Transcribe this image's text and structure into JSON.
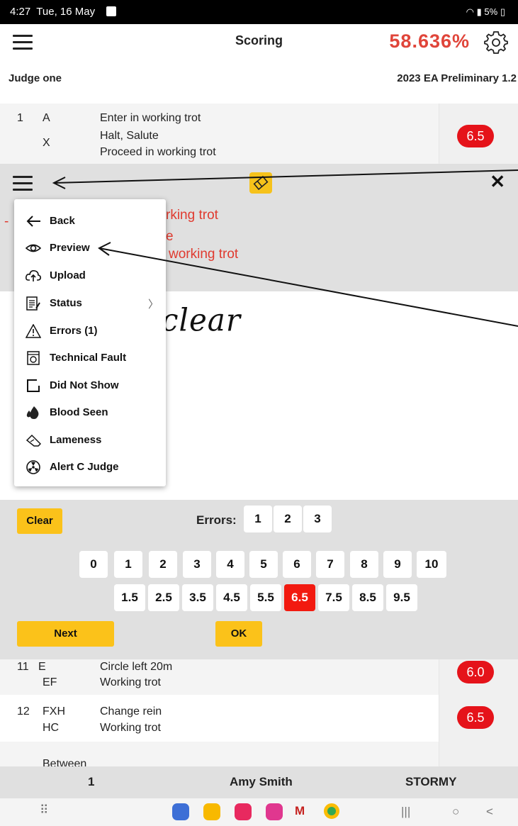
{
  "status_bar": {
    "time": "4:27",
    "date": "Tue, 16 May",
    "battery": "5%",
    "indicators": [
      "wifi-icon",
      "volte-icon",
      "signal-icon",
      "battery-icon"
    ]
  },
  "app_bar": {
    "title": "Scoring",
    "score": "58.636%",
    "score_color": "#e0453a",
    "menu_icon": "hamburger-icon",
    "settings_icon": "gear-icon"
  },
  "judge": {
    "name": "Judge one",
    "test": "2023 EA Preliminary 1.2"
  },
  "top_movement": {
    "number": "1",
    "markers": [
      "A",
      "X",
      ""
    ],
    "descriptions": [
      "Enter in working trot",
      "Halt, Salute",
      "Proceed in working trot"
    ],
    "mark": "6.5"
  },
  "editor": {
    "toolbar": {
      "menu_icon": "hamburger-icon",
      "eraser_icon": "eraser-icon",
      "close_label": "✕"
    },
    "partial_text": [
      "rking trot",
      "e",
      "working trot"
    ],
    "handwriting": "clear"
  },
  "menu": {
    "items": [
      {
        "label": "Back",
        "icon": "arrow-left-icon",
        "submenu": false
      },
      {
        "label": "Preview",
        "icon": "eye-icon",
        "submenu": false
      },
      {
        "label": "Upload",
        "icon": "cloud-upload-icon",
        "submenu": false
      },
      {
        "label": "Status",
        "icon": "clipboard-icon",
        "submenu": true
      },
      {
        "label": "Errors (1)",
        "icon": "warning-icon",
        "submenu": false
      },
      {
        "label": "Technical Fault",
        "icon": "technical-fault-icon",
        "submenu": false
      },
      {
        "label": "Did Not Show",
        "icon": "square-outline-icon",
        "submenu": false
      },
      {
        "label": "Blood Seen",
        "icon": "droplets-icon",
        "submenu": false
      },
      {
        "label": "Lameness",
        "icon": "horse-leg-icon",
        "submenu": false
      },
      {
        "label": "Alert C Judge",
        "icon": "radiation-icon",
        "submenu": false
      }
    ],
    "submenu_chevron": "〉"
  },
  "keypad": {
    "clear_label": "Clear",
    "errors_label": "Errors:",
    "error_buttons": [
      "1",
      "2",
      "3"
    ],
    "whole_marks": [
      "0",
      "1",
      "2",
      "3",
      "4",
      "5",
      "6",
      "7",
      "8",
      "9",
      "10"
    ],
    "half_marks": [
      "1.5",
      "2.5",
      "3.5",
      "4.5",
      "5.5",
      "6.5",
      "7.5",
      "8.5",
      "9.5"
    ],
    "selected": "6.5",
    "selected_color": "#f21a10",
    "next_label": "Next",
    "ok_label": "OK"
  },
  "movements": [
    {
      "number": "11",
      "markers": [
        "E",
        "EF"
      ],
      "descriptions": [
        "Circle left 20m",
        "Working trot"
      ],
      "mark": "6.0"
    },
    {
      "number": "12",
      "markers": [
        "FXH",
        "HC"
      ],
      "descriptions": [
        "Change rein",
        "Working trot"
      ],
      "mark": "6.5"
    },
    {
      "number": "",
      "markers": [
        ""
      ],
      "descriptions": [
        "Between"
      ],
      "mark": ""
    }
  ],
  "footer": {
    "competitor_number": "1",
    "rider": "Amy Smith",
    "horse": "STORMY"
  },
  "nav": {
    "apps": [
      "apps-grid-icon",
      "settings-app-icon",
      "files-app-icon",
      "camera-app-icon",
      "blossom-app-icon",
      "gmail-app-icon",
      "chrome-app-icon"
    ],
    "recents": "|||",
    "home": "○",
    "back": "<"
  }
}
